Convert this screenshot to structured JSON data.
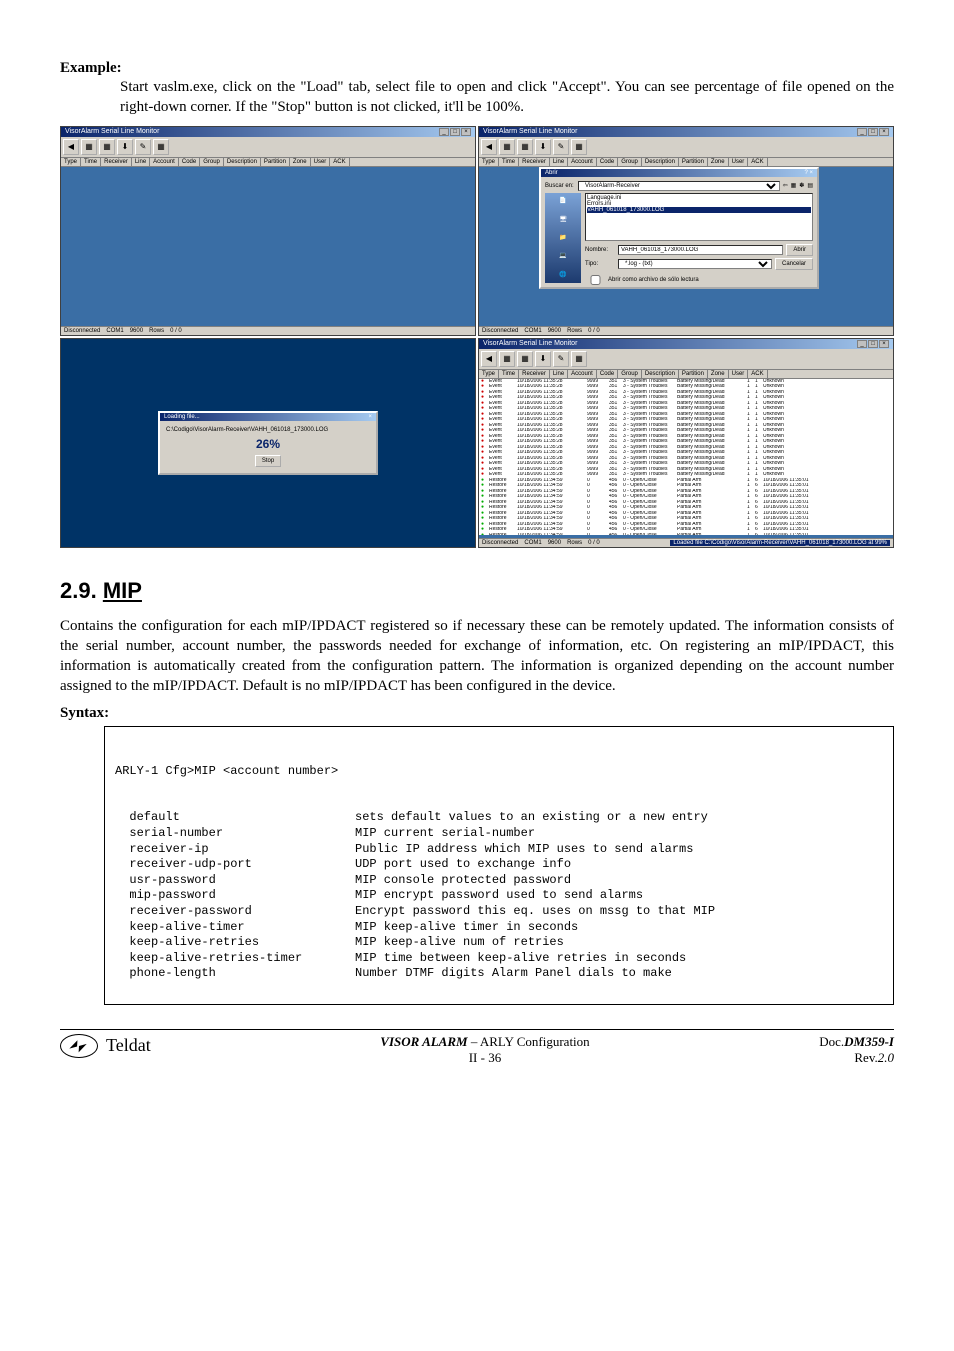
{
  "example": {
    "label": "Example:",
    "text": "Start vaslm.exe, click on the \"Load\" tab, select file to open and click \"Accept\". You can see percentage of file opened on the right-down corner. If the \"Stop\" button is not clicked, it'll be 100%."
  },
  "app": {
    "title": "VisorAlarm Serial Line Monitor",
    "toolbar_icons": [
      "◀",
      "▦",
      "▦",
      "⬇",
      "✎",
      "▦"
    ],
    "columns": [
      "Type",
      "Time",
      "Receiver",
      "Line",
      "Account",
      "Code",
      "Group",
      "Description",
      "Partition",
      "Zone",
      "User",
      "ACK"
    ],
    "status": {
      "conn": "Disconnected",
      "port": "COM1",
      "baud": "9600",
      "rows": "Rows",
      "rows_val": "0 / 0"
    }
  },
  "open_dialog": {
    "title": "Abrir",
    "lookin_label": "Buscar en:",
    "lookin_value": "VisorAlarm-Receiver",
    "files": [
      "Language.ini",
      "Errors.ini",
      "VAHH_061018_173000.LOG"
    ],
    "name_label": "Nombre:",
    "name_value": "VAHH_061018_173000.LOG",
    "type_label": "Tipo:",
    "type_value": "*.log - (txt)",
    "readonly": "Abrir como archivo de sólo lectura",
    "open": "Abrir",
    "cancel": "Cancelar"
  },
  "loading_dialog": {
    "title": "Loading file...",
    "path": "C:\\Codigo\\VisorAlarm-Receiver\\VAHH_061018_173000.LOG",
    "percent": "26%",
    "stop": "Stop"
  },
  "events_sample": {
    "red": {
      "type": "Event",
      "time": "10/18/2006 11:35:28",
      "acct": "9999",
      "code": "351",
      "grp": "3 - System Troubles",
      "desc": "Battery Missing/Dead",
      "part": "1",
      "zone": "1",
      "luser": "Unknown"
    },
    "green": {
      "type": "Restore",
      "time": "10/18/2006 11:34:59",
      "acct": "0",
      "code": "456",
      "grp": "0 - Open/Close",
      "desc": "Partial Arm",
      "part": "1",
      "zone": "6",
      "luser": "10/18/2006 11:35:01"
    },
    "status_rows": "0 / 0",
    "loaded_footer": "Loaded file C:\\Codigo\\VisorAlarm-Receiver\\VAHH_061018_173000.LOG at 99%"
  },
  "section": {
    "number": "2.9.",
    "title": "MIP",
    "para": "Contains the configuration for each mIP/IPDACT registered so if necessary these can be remotely updated.  The information consists of the serial number, account number, the passwords needed for exchange of information, etc.  On registering an mIP/IPDACT, this information is automatically created from the configuration pattern.  The information is organized depending on the account number assigned to the mIP/IPDACT.  Default is no mIP/IPDACT has been configured in the device.",
    "syntax_label": "Syntax:"
  },
  "syntax": {
    "header": "ARLY-1 Cfg>MIP <account number>",
    "rows": [
      {
        "cmd": "  default",
        "desc": "sets default values to an existing or a new entry"
      },
      {
        "cmd": "  serial-number",
        "desc": "MIP current serial-number"
      },
      {
        "cmd": "  receiver-ip",
        "desc": "Public IP address which MIP uses to send alarms"
      },
      {
        "cmd": "  receiver-udp-port",
        "desc": "UDP port used to exchange info"
      },
      {
        "cmd": "  usr-password",
        "desc": "MIP console protected password"
      },
      {
        "cmd": "  mip-password",
        "desc": "MIP encrypt password used to send alarms"
      },
      {
        "cmd": "  receiver-password",
        "desc": "Encrypt password this eq. uses on mssg to that MIP"
      },
      {
        "cmd": "  keep-alive-timer",
        "desc": "MIP keep-alive timer in seconds"
      },
      {
        "cmd": "  keep-alive-retries",
        "desc": "MIP keep-alive num of retries"
      },
      {
        "cmd": "  keep-alive-retries-timer",
        "desc": "MIP time between keep-alive retries in seconds"
      },
      {
        "cmd": "  phone-length",
        "desc": "Number DTMF digits Alarm Panel dials to make"
      }
    ]
  },
  "footer": {
    "brand": "Teldat",
    "center_top": "VISOR ALARM – ARLY Configuration",
    "center_bottom": "II - 36",
    "doc": "Doc.DM359-I",
    "rev": "Rev.2.0"
  }
}
